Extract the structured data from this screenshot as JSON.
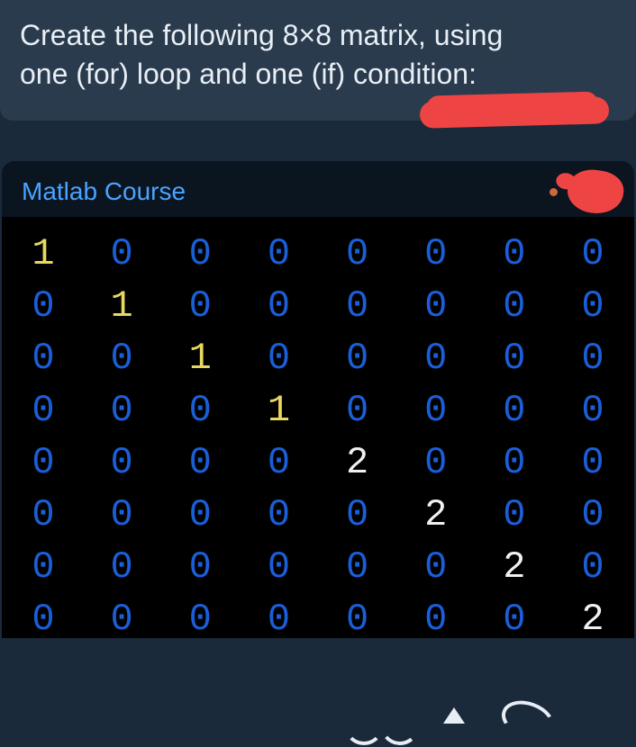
{
  "question": {
    "line1": "Create the following 8×8 matrix, using",
    "line2": "one (for) loop and one (if) condition:"
  },
  "course_label": "Matlab Course",
  "chart_data": {
    "type": "table",
    "title": "8×8 matrix",
    "rows": [
      [
        1,
        0,
        0,
        0,
        0,
        0,
        0,
        0
      ],
      [
        0,
        1,
        0,
        0,
        0,
        0,
        0,
        0
      ],
      [
        0,
        0,
        1,
        0,
        0,
        0,
        0,
        0
      ],
      [
        0,
        0,
        0,
        1,
        0,
        0,
        0,
        0
      ],
      [
        0,
        0,
        0,
        0,
        2,
        0,
        0,
        0
      ],
      [
        0,
        0,
        0,
        0,
        0,
        2,
        0,
        0
      ],
      [
        0,
        0,
        0,
        0,
        0,
        0,
        2,
        0
      ],
      [
        0,
        0,
        0,
        0,
        0,
        0,
        0,
        2
      ]
    ]
  }
}
